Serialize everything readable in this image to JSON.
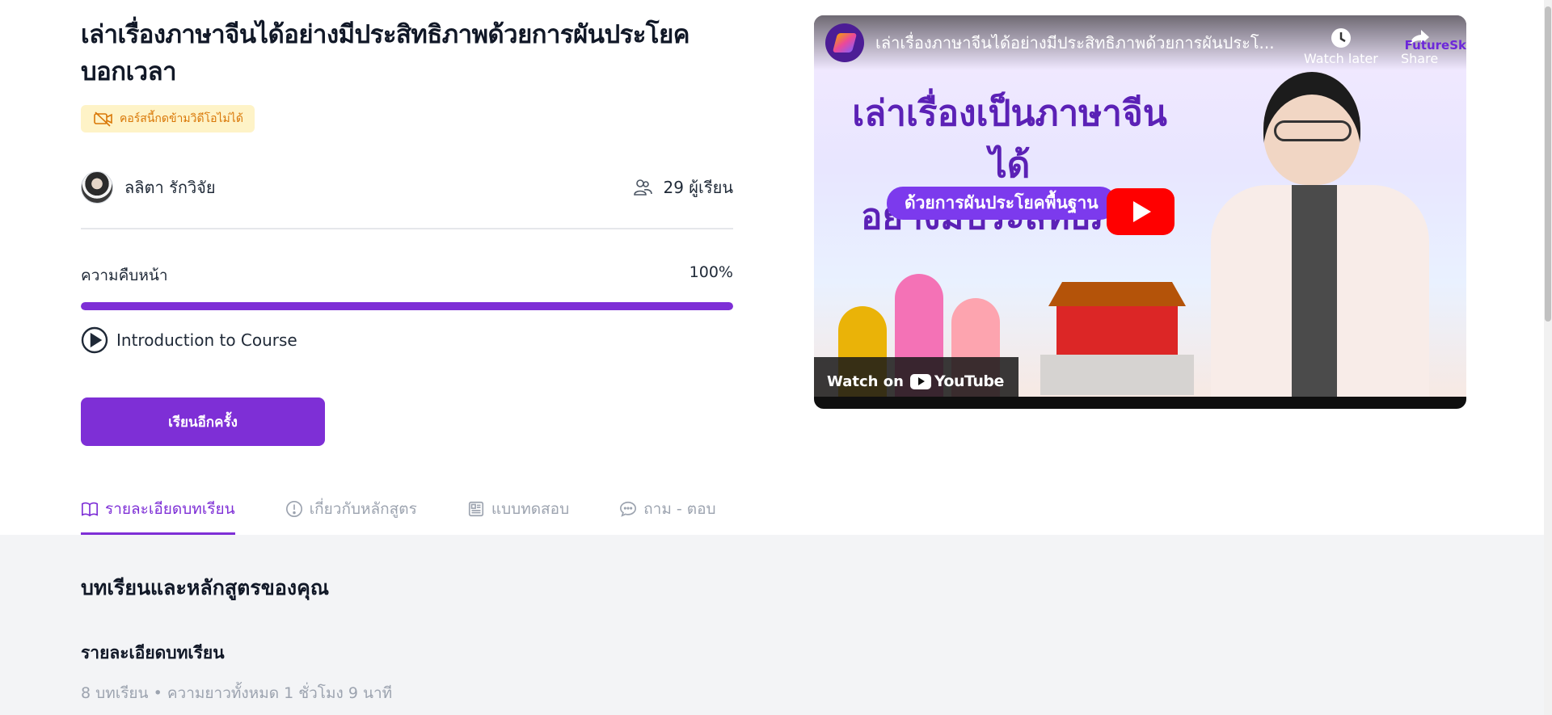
{
  "course": {
    "title": "เล่าเรื่องภาษาจีนได้อย่างมีประสิทธิภาพด้วยการผันประโยคบอกเวลา",
    "badge": "คอร์สนี้กดข้ามวิดีโอไม่ได้",
    "instructor": "ลลิตา รักวิจัย",
    "learners": "29 ผู้เรียน",
    "progress_label": "ความคืบหน้า",
    "progress_text": "100%",
    "progress_value": 100,
    "current_lesson": "Introduction to Course",
    "restart_button": "เรียนอีกครั้ง"
  },
  "tabs": [
    {
      "label": "รายละเอียดบทเรียน",
      "icon": "book-icon",
      "active": true
    },
    {
      "label": "เกี่ยวกับหลักสูตร",
      "icon": "info-icon",
      "active": false
    },
    {
      "label": "แบบทดสอบ",
      "icon": "newspaper-icon",
      "active": false
    },
    {
      "label": "ถาม - ตอบ",
      "icon": "chat-icon",
      "active": false
    }
  ],
  "details": {
    "heading": "บทเรียนและหลักสูตรของคุณ",
    "subheading": "รายละเอียดบทเรียน",
    "meta": "8 บทเรียน • ความยาวทั้งหมด 1 ชั่วโมง 9 นาที"
  },
  "video": {
    "title": "เล่าเรื่องภาษาจีนได้อย่างมีประสิทธิภาพด้วยการผันประโ...",
    "watch_later": "Watch later",
    "share": "Share",
    "brand": "FutureSk",
    "thumb_headline_1": "เล่าเรื่องเป็นภาษาจีนได้",
    "thumb_headline_2": "อย่างมีประสิทธิภาพ",
    "thumb_pill": "ด้วยการผันประโยคพื้นฐาน",
    "watch_on": "Watch on",
    "youtube": "YouTube"
  },
  "colors": {
    "accent": "#7e2fd6",
    "badge_bg": "#fef3c7",
    "badge_text": "#d97706",
    "muted": "#9ca3af",
    "details_bg": "#f3f4f6"
  }
}
